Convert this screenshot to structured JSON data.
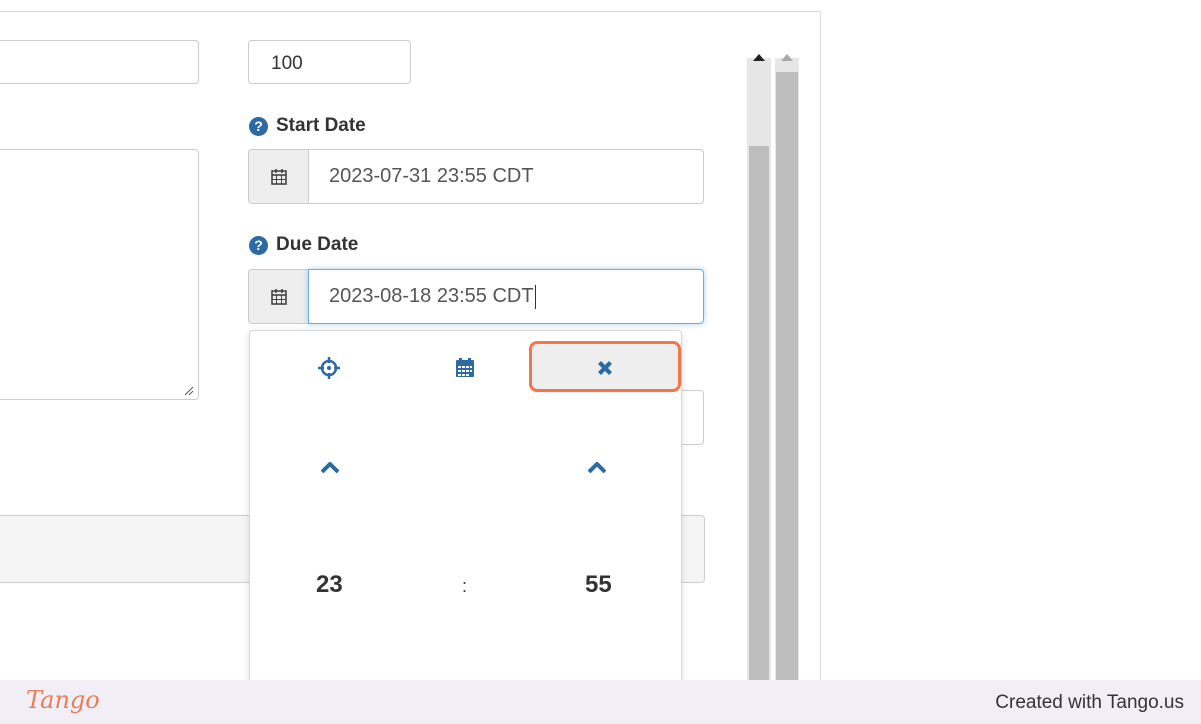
{
  "form": {
    "points_value": "100",
    "start_date": {
      "label": "Start Date",
      "value": "2023-07-31 23:55 CDT"
    },
    "due_date": {
      "label": "Due Date",
      "value": "2023-08-18 23:55 CDT"
    }
  },
  "picker": {
    "hour": "23",
    "separator": ":",
    "minute": "55"
  },
  "colors": {
    "accent": "#2c6aa5",
    "highlight": "#f0774a",
    "focus": "#66afe9"
  },
  "footer": {
    "logo_text": "Tango",
    "credit": "Created with Tango.us"
  }
}
